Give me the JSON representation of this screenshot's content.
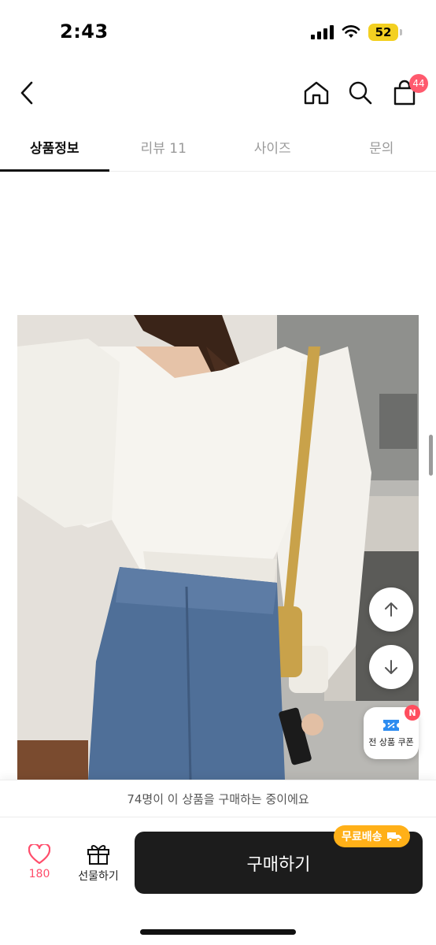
{
  "status_bar": {
    "time": "2:43",
    "battery": "52",
    "signal_icon": "cellular-signal-icon",
    "wifi_icon": "wifi-icon",
    "battery_color": "#f3d021"
  },
  "header": {
    "back_icon": "chevron-left-icon",
    "home_icon": "home-icon",
    "search_icon": "search-icon",
    "cart_icon": "shopping-bag-icon",
    "cart_badge": "44",
    "badge_color": "#ff5a6e"
  },
  "tabs": [
    {
      "label": "상품정보",
      "active": true
    },
    {
      "label": "리뷰 11",
      "active": false
    },
    {
      "label": "사이즈",
      "active": false
    },
    {
      "label": "문의",
      "active": false
    }
  ],
  "product_image": {
    "icon": "product-photo"
  },
  "floating": {
    "scroll_up_icon": "arrow-up-icon",
    "scroll_down_icon": "arrow-down-icon",
    "coupon_label": "전 상품 쿠폰",
    "coupon_badge": "N",
    "coupon_icon": "coupon-icon"
  },
  "buyer_notice": "74명이 이 상품을 구매하는 중이에요",
  "bottom_bar": {
    "like_count": "180",
    "like_icon": "heart-icon",
    "gift_label": "선물하기",
    "gift_icon": "gift-icon",
    "buy_label": "구매하기",
    "free_shipping_label": "무료배송",
    "truck_icon": "truck-icon",
    "buy_color": "#1c1c1c",
    "free_shipping_color": "#ffb018"
  }
}
